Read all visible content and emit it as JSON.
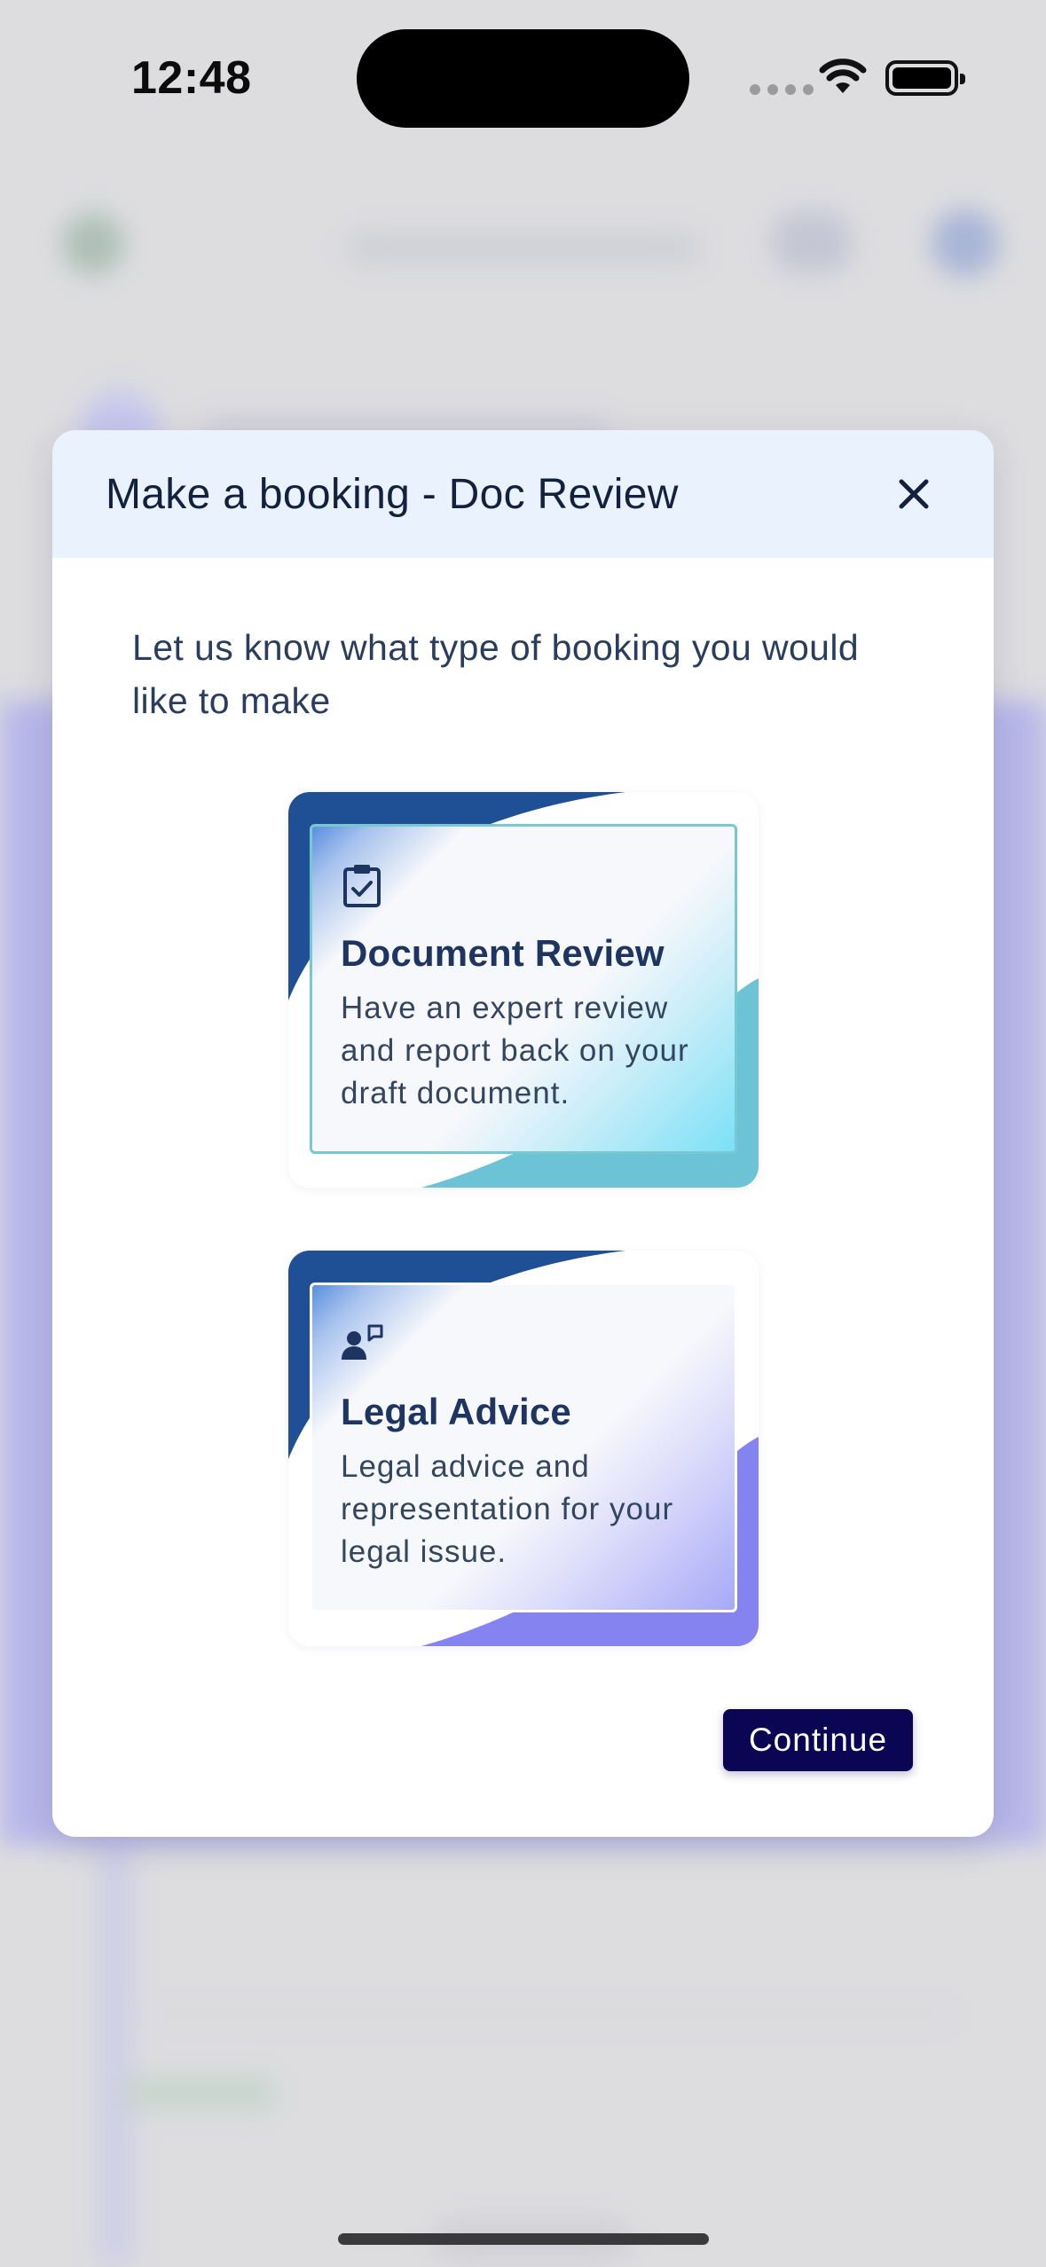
{
  "status_bar": {
    "time": "12:48"
  },
  "modal": {
    "title": "Make a booking - Doc Review",
    "intro": "Let us know what type of booking you would like to make",
    "options": [
      {
        "title": "Document Review",
        "description": "Have an expert review and report back on your draft document.",
        "icon": "clipboard-check-icon",
        "selected": true,
        "accent": "#6cc3d6"
      },
      {
        "title": "Legal Advice",
        "description": "Legal advice and representation for your legal issue.",
        "icon": "person-chat-icon",
        "selected": false,
        "accent": "#8583f0"
      }
    ],
    "continue_label": "Continue"
  },
  "colors": {
    "header_bg": "#eaf2fe",
    "primary_button": "#0b0654",
    "dark_blue": "#1f4f95"
  }
}
